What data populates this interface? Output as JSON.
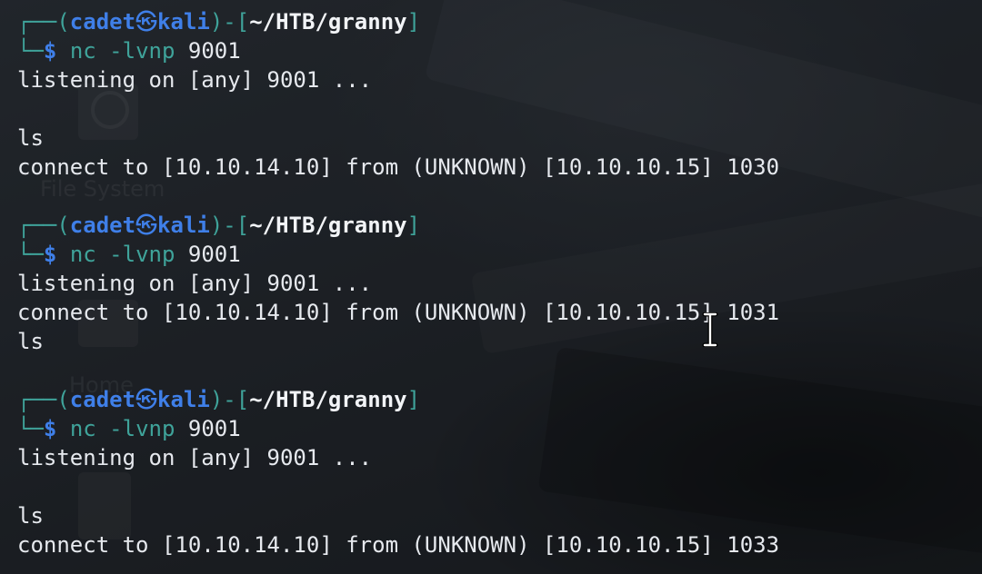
{
  "prompt": {
    "user": "cadet",
    "host": "kali",
    "cwd": "~/HTB/granny",
    "symbol": "$"
  },
  "blocks": [
    {
      "command": {
        "name": "nc",
        "args": " -lvnp ",
        "port": "9001"
      },
      "output": [
        "listening on [any] 9001 ...",
        "",
        "ls",
        "connect to [10.10.14.10] from (UNKNOWN) [10.10.10.15] 1030",
        ""
      ]
    },
    {
      "command": {
        "name": "nc",
        "args": " -lvnp ",
        "port": "9001"
      },
      "output": [
        "listening on [any] 9001 ...",
        "connect to [10.10.14.10] from (UNKNOWN) [10.10.10.15] 1031",
        "ls",
        ""
      ]
    },
    {
      "command": {
        "name": "nc",
        "args": " -lvnp ",
        "port": "9001"
      },
      "output": [
        "listening on [any] 9001 ...",
        "",
        "ls",
        "connect to [10.10.14.10] from (UNKNOWN) [10.10.10.15] 1033"
      ]
    }
  ],
  "desktop": {
    "icons": [
      {
        "name": "File System",
        "icon": "drive-icon"
      },
      {
        "name": "Home",
        "icon": "home-folder-icon"
      },
      {
        "name": "",
        "icon": "document-icon"
      }
    ]
  },
  "colors": {
    "frame": "#3fa39a",
    "user": "#3f7fe8",
    "command": "#3fa39a",
    "text": "#e6e9ee"
  },
  "cursor": {
    "icon": "text-ibeam-cursor-icon"
  }
}
